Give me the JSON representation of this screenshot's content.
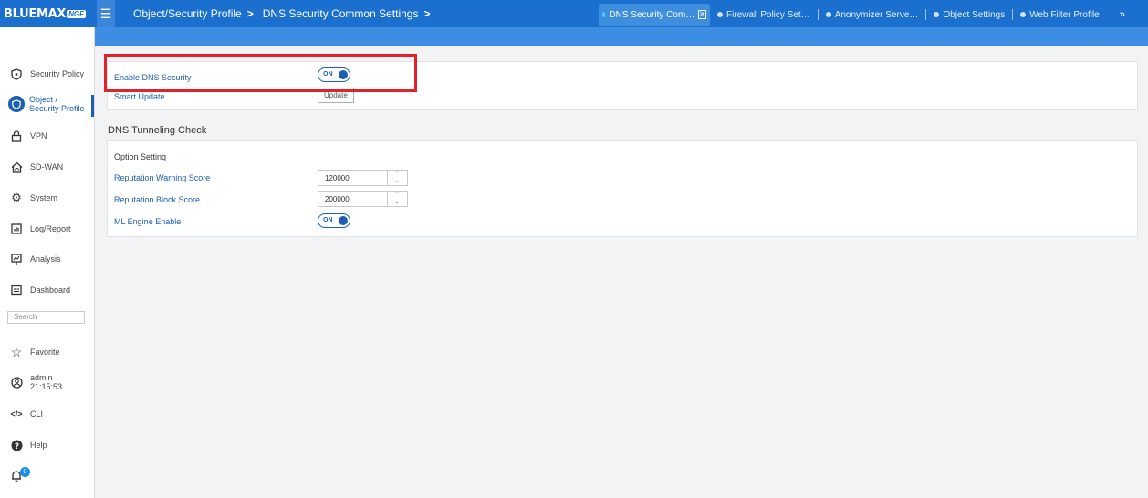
{
  "header": {
    "logo": "BLUEMAX",
    "logo_suffix": "NGF",
    "breadcrumb": [
      "Object/Security Profile",
      "DNS Security Common Settings"
    ],
    "tabs": [
      {
        "label": "DNS Security Com…",
        "active": true
      },
      {
        "label": "Firewall Policy Set…",
        "active": false
      },
      {
        "label": "Anonymizer Serve…",
        "active": false
      },
      {
        "label": "Object Settings",
        "active": false
      },
      {
        "label": "Web Filter Profile",
        "active": false
      }
    ],
    "more": "»"
  },
  "sidebar": {
    "items": [
      {
        "label": "Security Policy",
        "icon": "shield-icon"
      },
      {
        "label": "Object /",
        "label2": "Security Profile",
        "icon": "object-profile-icon",
        "active": true
      },
      {
        "label": "VPN",
        "icon": "lock-icon"
      },
      {
        "label": "SD-WAN",
        "icon": "home-network-icon"
      },
      {
        "label": "System",
        "icon": "gear-icon"
      },
      {
        "label": "Log/Report",
        "icon": "report-icon"
      },
      {
        "label": "Analysis",
        "icon": "analysis-icon"
      },
      {
        "label": "Dashboard",
        "icon": "dashboard-icon"
      }
    ],
    "search_placeholder": "Search",
    "bottom": [
      {
        "label": "Favorite",
        "icon": "star-icon"
      },
      {
        "label": "admin",
        "label2": "21:15:53",
        "icon": "user-icon"
      },
      {
        "label": "CLI",
        "icon": "code-icon"
      },
      {
        "label": "Help",
        "icon": "help-icon"
      }
    ],
    "notification_count": "0"
  },
  "main": {
    "general": {
      "enable_label": "Enable DNS Security",
      "enable_state": "ON",
      "smart_update_label": "Smart Update",
      "update_button": "Update"
    },
    "tunneling": {
      "title": "DNS Tunneling Check",
      "option_title": "Option Setting",
      "warning_label": "Reputation Warning Score",
      "warning_value": "120000",
      "block_label": "Reputation Block Score",
      "block_value": "200000",
      "ml_label": "ML Engine Enable",
      "ml_state": "ON"
    }
  },
  "colors": {
    "brand": "#1a6fcf",
    "accent": "#1a5fb4",
    "highlight": "#e0232b"
  }
}
